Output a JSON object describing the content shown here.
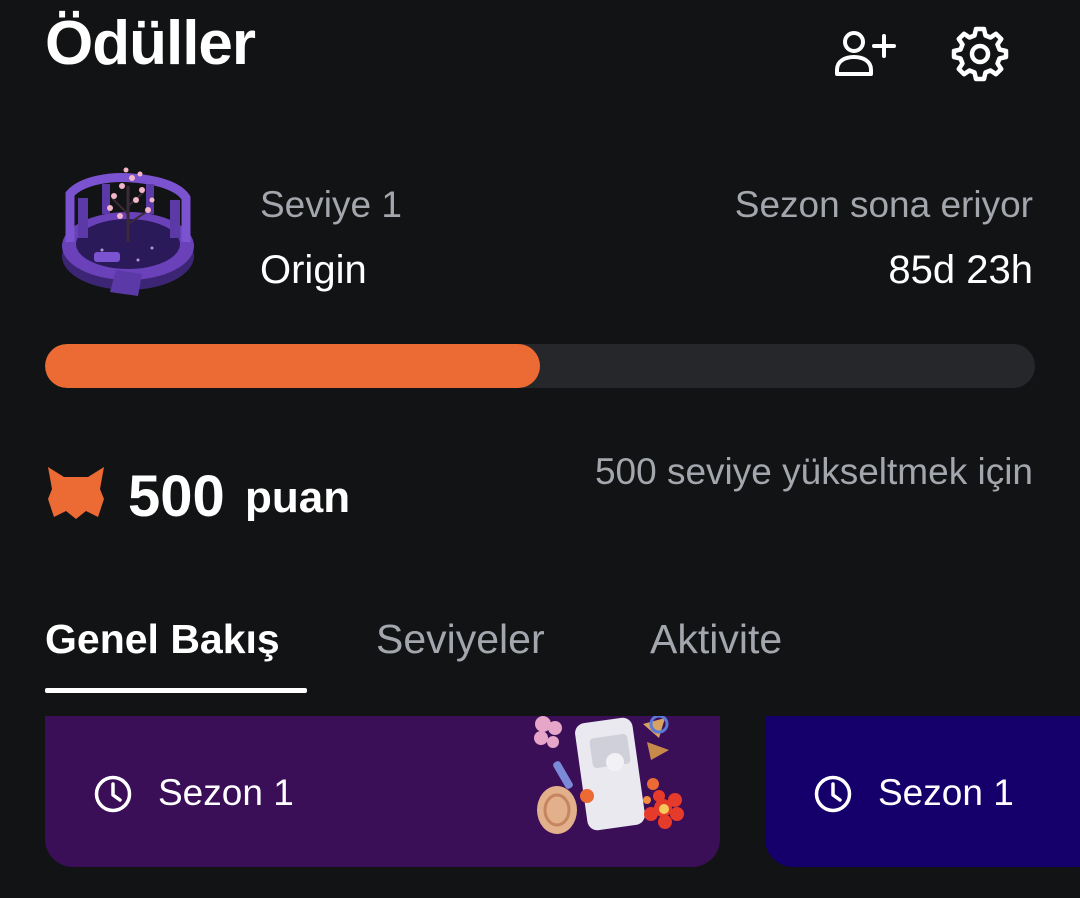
{
  "header": {
    "title": "Ödüller",
    "icons": [
      "add-user-icon",
      "gear-icon"
    ]
  },
  "level": {
    "label": "Seviye 1",
    "name": "Origin",
    "art_icon": "fountain-garden-icon"
  },
  "season": {
    "label": "Sezon sona eriyor",
    "time_left": "85d 23h"
  },
  "progress": {
    "fraction": 0.5,
    "fill_color": "#ec6a34",
    "track_color": "#26272a"
  },
  "points": {
    "icon": "fox-icon",
    "value": "500",
    "unit": "puan",
    "note": "500 seviye yükseltmek için"
  },
  "tabs": [
    {
      "label": "Genel Bakış",
      "active": true
    },
    {
      "label": "Seviyeler",
      "active": false
    },
    {
      "label": "Aktivite",
      "active": false
    }
  ],
  "cards": [
    {
      "label": "Sezon 1",
      "icon": "clock-icon",
      "color": "#3b0e58"
    },
    {
      "label": "Sezon 1",
      "icon": "clock-icon",
      "color": "#15006b"
    }
  ]
}
